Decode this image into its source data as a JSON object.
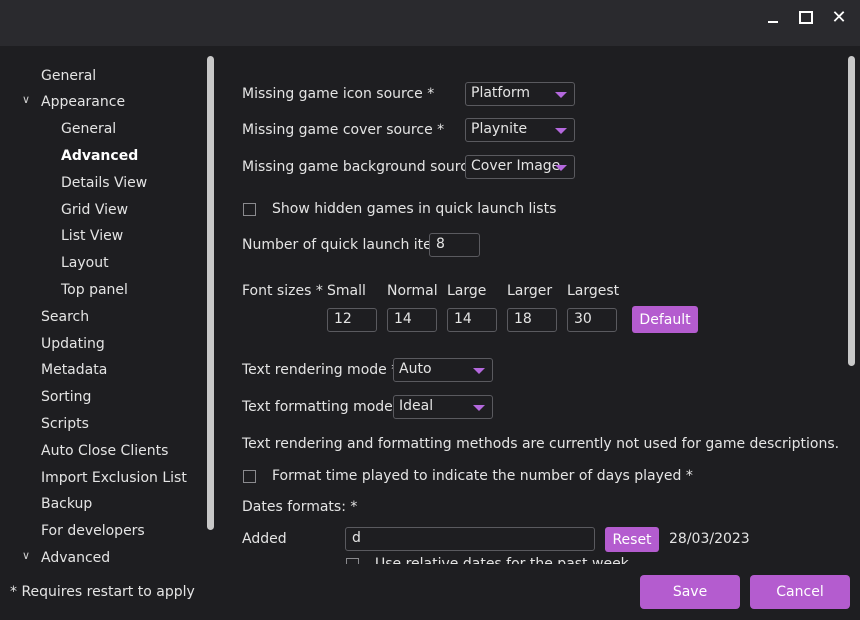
{
  "window": {
    "minimize_icon": "minimize-icon",
    "maximize_icon": "maximize-icon",
    "close_icon": "close-icon",
    "close_glyph": "✕"
  },
  "sidebar": {
    "items": [
      {
        "label": "General"
      },
      {
        "label": "Appearance",
        "expanded": true
      },
      {
        "label": "General"
      },
      {
        "label": "Advanced",
        "selected": true
      },
      {
        "label": "Details View"
      },
      {
        "label": "Grid View"
      },
      {
        "label": "List View"
      },
      {
        "label": "Layout"
      },
      {
        "label": "Top panel"
      },
      {
        "label": "Search"
      },
      {
        "label": "Updating"
      },
      {
        "label": "Metadata"
      },
      {
        "label": "Sorting"
      },
      {
        "label": "Scripts"
      },
      {
        "label": "Auto Close Clients"
      },
      {
        "label": "Import Exclusion List"
      },
      {
        "label": "Backup"
      },
      {
        "label": "For developers"
      },
      {
        "label": "Advanced",
        "expanded": true
      }
    ]
  },
  "content": {
    "icon_source_label": "Missing game icon source *",
    "icon_source_value": "Platform",
    "cover_source_label": "Missing game cover source *",
    "cover_source_value": "Playnite",
    "background_source_label": "Missing game background source *",
    "background_source_value": "Cover Image",
    "hidden_games_label": "Show hidden games in quick launch lists",
    "quick_launch_label": "Number of quick launch items",
    "quick_launch_value": "8",
    "font_sizes_label": "Font sizes *",
    "font_sizes": [
      {
        "label": "Small",
        "value": "12"
      },
      {
        "label": "Normal",
        "value": "14"
      },
      {
        "label": "Large",
        "value": "14"
      },
      {
        "label": "Larger",
        "value": "18"
      },
      {
        "label": "Largest",
        "value": "30"
      }
    ],
    "default_button": "Default",
    "rendering_mode_label": "Text rendering mode *",
    "rendering_mode_value": "Auto",
    "formatting_mode_label": "Text formatting mode *",
    "formatting_mode_value": "Ideal",
    "rendering_note": "Text rendering and formatting methods are currently not used for game descriptions.",
    "time_played_label": "Format time played to indicate the number of days played *",
    "dates_formats_label": "Dates formats: *",
    "added_label": "Added",
    "added_value": "d",
    "reset_button": "Reset",
    "added_preview": "28/03/2023",
    "relative_dates_label": "Use relative dates for the past week"
  },
  "footer": {
    "restart_note": "* Requires restart to apply",
    "save_button": "Save",
    "cancel_button": "Cancel"
  },
  "colors": {
    "accent": "#b45ccf",
    "background": "#1e1e21",
    "titlebar": "#2a2a2e"
  }
}
